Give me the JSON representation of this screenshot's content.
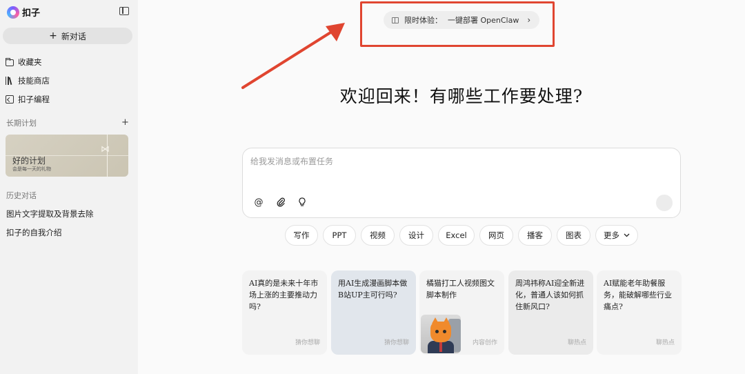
{
  "app": {
    "name": "扣子"
  },
  "sidebar": {
    "new_chat_label": "新对话",
    "nav": [
      {
        "label": "收藏夹"
      },
      {
        "label": "技能商店"
      },
      {
        "label": "扣子编程"
      }
    ],
    "long_term_section": "长期计划",
    "plan_card": {
      "title": "好的计划",
      "subtitle": "会是每一天的礼物"
    },
    "history_section": "历史对话",
    "history": [
      {
        "label": "图片文字提取及背景去除"
      },
      {
        "label": "扣子的自我介绍"
      }
    ]
  },
  "promo": {
    "label": "限时体验：",
    "text": "一键部署 OpenClaw"
  },
  "main": {
    "welcome": "欢迎回来！有哪些工作要处理?",
    "composer_placeholder": "给我发消息或布置任务",
    "chips": [
      "写作",
      "PPT",
      "视频",
      "设计",
      "Excel",
      "网页",
      "播客",
      "图表",
      "更多"
    ],
    "cards": [
      {
        "text": "AI真的是未来十年市场上涨的主要推动力吗?",
        "tag": "猜你想聊"
      },
      {
        "text": "用AI生成漫画脚本做B站UP主可行吗?",
        "tag": "猜你想聊"
      },
      {
        "text": "橘猫打工人视频图文脚本制作",
        "tag": "内容创作"
      },
      {
        "text": "周鸿祎称AI迎全新进化，普通人该如何抓住新风口?",
        "tag": "聊热点"
      },
      {
        "text": "AI赋能老年助餐服务，能破解哪些行业痛点?",
        "tag": "聊热点"
      }
    ]
  },
  "colors": {
    "annotation_red": "#e04530",
    "sidebar_bg": "#f2f2f2",
    "page_bg": "#fafafa"
  },
  "icons": [
    "logo-icon",
    "sidebar-toggle-icon",
    "plus-icon",
    "folder-icon",
    "books-icon",
    "code-icon",
    "gift-icon",
    "chevron-right-icon",
    "at-icon",
    "paperclip-icon",
    "lightbulb-icon",
    "chevron-down-icon"
  ]
}
